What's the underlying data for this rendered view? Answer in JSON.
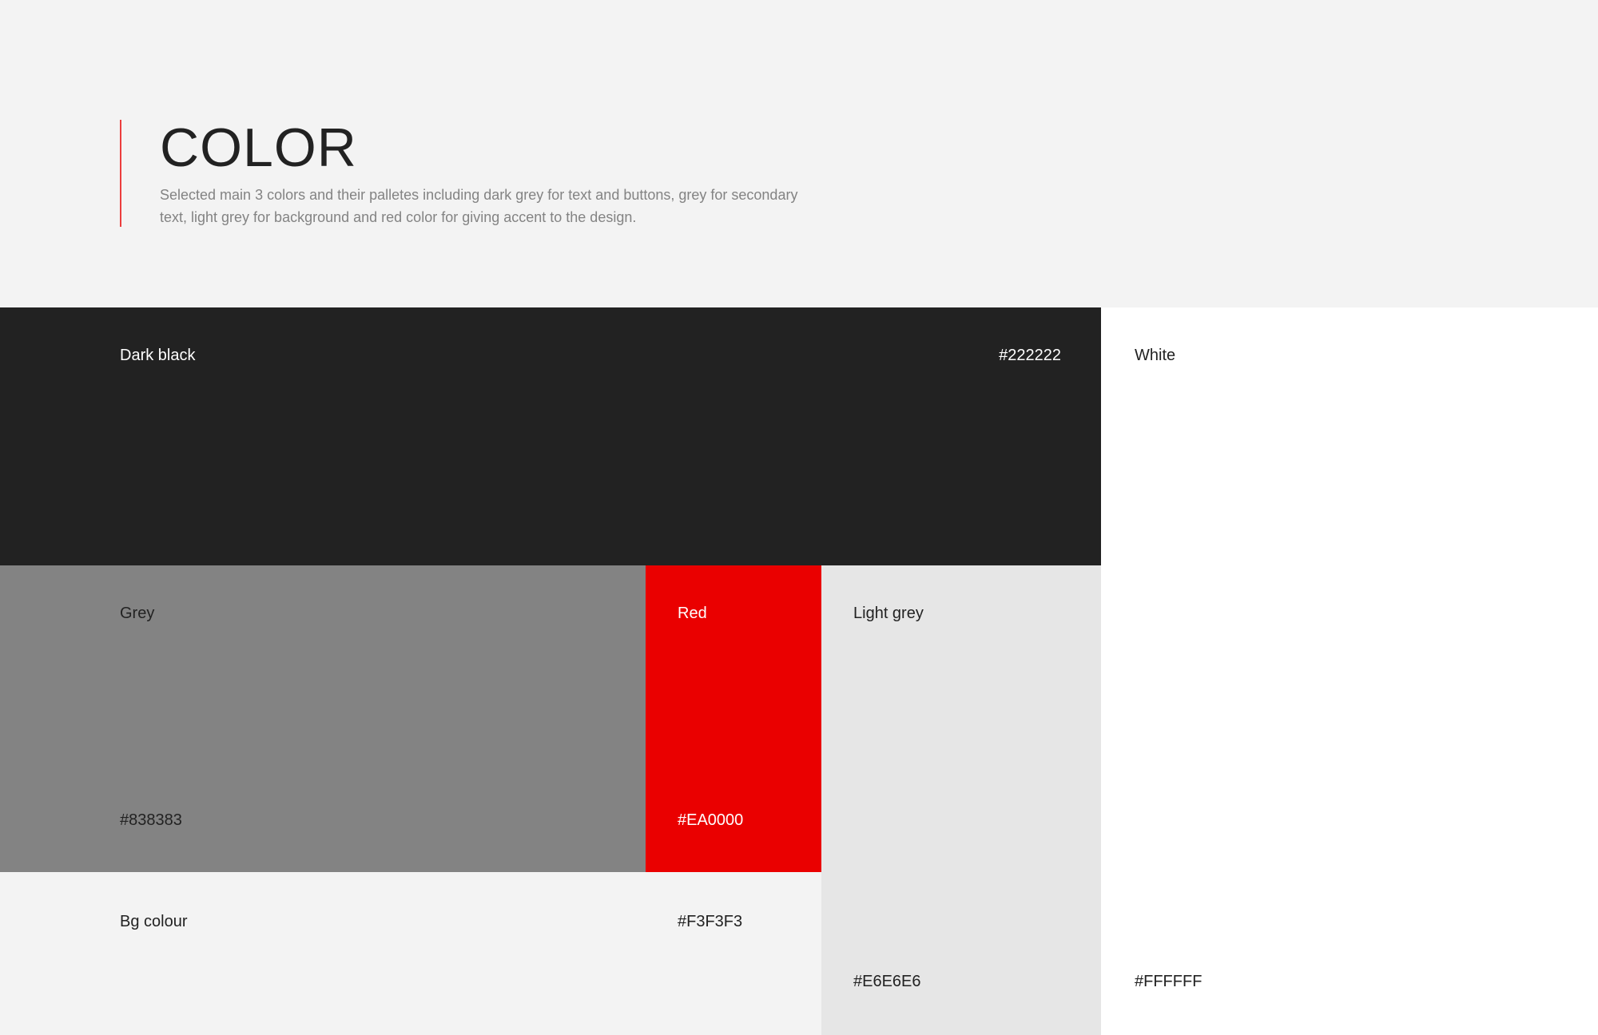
{
  "header": {
    "title": "COLOR",
    "description": "Selected main 3 colors and their palletes including dark grey for text and buttons, grey for secondary text, light grey for background and red color for giving accent to the design."
  },
  "swatches": {
    "dark_black": {
      "name": "Dark black",
      "hex": "#222222"
    },
    "white": {
      "name": "White",
      "hex": "#FFFFFF"
    },
    "grey": {
      "name": "Grey",
      "hex": "#838383"
    },
    "red": {
      "name": "Red",
      "hex": "#EA0000"
    },
    "light_grey": {
      "name": "Light grey",
      "hex": "#E6E6E6"
    },
    "bg_colour": {
      "name": "Bg colour",
      "hex": "#F3F3F3"
    }
  }
}
